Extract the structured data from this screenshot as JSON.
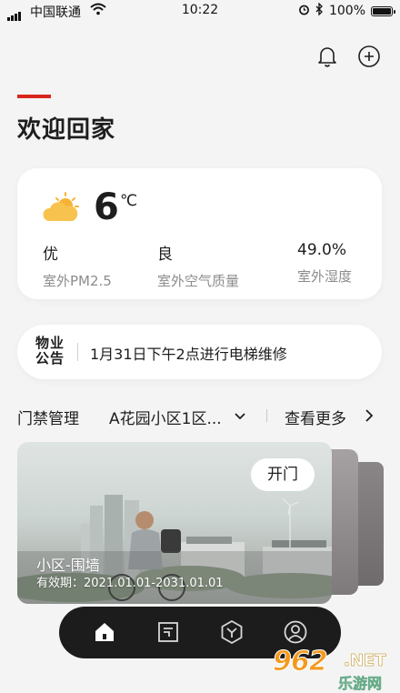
{
  "status_bar": {
    "carrier": "中国联通",
    "time": "10:22",
    "battery": "100%",
    "battery_level": 1.0
  },
  "header": {
    "bell_icon": "bell-icon",
    "add_icon": "plus-circle-icon",
    "title": "欢迎回家",
    "accent_color": "#d9261c"
  },
  "weather": {
    "icon": "sun-cloud-icon",
    "temperature": "6",
    "unit": "℃",
    "stats": [
      {
        "value": "优",
        "label": "室外PM2.5"
      },
      {
        "value": "良",
        "label": "室外空气质量"
      },
      {
        "value": "49.0%",
        "label": "室外湿度"
      }
    ]
  },
  "notice": {
    "logo_line1": "物业",
    "logo_line2": "公告",
    "text": "1月31日下午2点进行电梯维修"
  },
  "access": {
    "title": "门禁管理",
    "community": "A花园小区1区...",
    "view_more": "查看更多"
  },
  "door_card": {
    "open_button": "开门",
    "name": "小区-围墙",
    "validity": "有效期：2021.01.01-2031.01.01"
  },
  "tabbar": {
    "tabs": [
      {
        "icon": "home-icon",
        "active": true
      },
      {
        "icon": "document-icon",
        "active": false
      },
      {
        "icon": "hexagon-y-icon",
        "active": false
      },
      {
        "icon": "user-icon",
        "active": false
      }
    ]
  },
  "watermark": {
    "number": "962",
    "suffix": ".NET",
    "site": "乐游网"
  }
}
